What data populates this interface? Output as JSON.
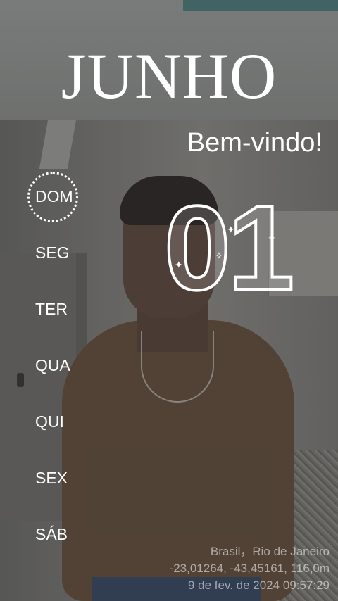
{
  "header": {
    "month": "JUNHO",
    "welcome": "Bem-vindo!"
  },
  "calendar": {
    "date_number": "01",
    "selected_day": "DOM",
    "days": [
      "DOM",
      "SEG",
      "TER",
      "QUA",
      "QUI",
      "SEX",
      "SÁB"
    ]
  },
  "photo_stamp": {
    "location": "Brasil，Rio de Janeiro",
    "coordinates": "-23,01264, -43,45161, 116,0m",
    "datetime": "9 de fev. de 2024 09:57:29"
  }
}
